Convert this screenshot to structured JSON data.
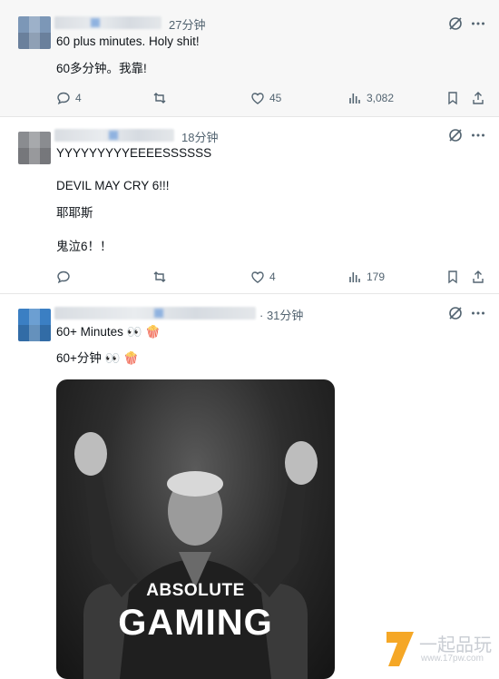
{
  "posts": [
    {
      "time": "27分钟",
      "lines": [
        "60 plus minutes. Holy shit!",
        "60多分钟。我靠!"
      ],
      "replies": "4",
      "reposts": "",
      "likes": "45",
      "views": "3,082"
    },
    {
      "time": "18分钟",
      "lines": [
        "YYYYYYYYYEEEESSSSSS",
        "DEVIL MAY CRY 6!!!",
        "耶耶斯",
        "鬼泣6！！"
      ],
      "replies": "",
      "reposts": "",
      "likes": "4",
      "views": "179"
    },
    {
      "time": "· 31分钟",
      "lines": [
        "60+ Minutes 👀 🍿",
        "60+分钟 👀 🍿"
      ],
      "media_text": [
        "ABSOLUTE",
        "GAMING"
      ]
    }
  ],
  "icons": {
    "grok": "grok-icon",
    "more": "more-icon",
    "reply": "reply-icon",
    "repost": "repost-icon",
    "like": "like-icon",
    "views": "views-icon",
    "bookmark": "bookmark-icon",
    "share": "share-icon"
  },
  "colors": {
    "text": "#0f1419",
    "muted": "#536471",
    "accent": "#f39800"
  },
  "watermark": {
    "brand": "一起品玩",
    "url": "www.17pw.com"
  }
}
